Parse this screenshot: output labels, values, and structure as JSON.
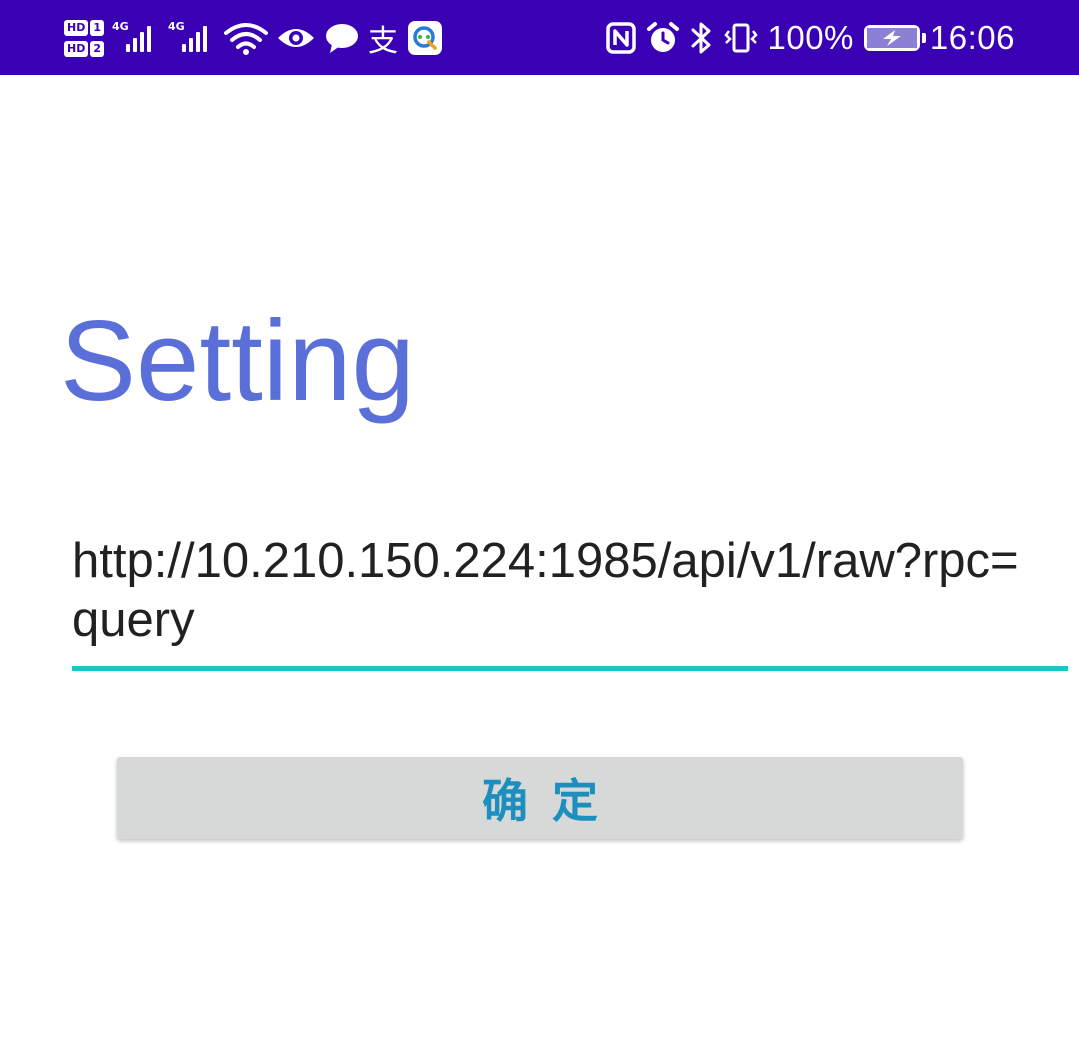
{
  "status_bar": {
    "sim1_label": "HD",
    "sim1_num": "1",
    "sim2_label": "HD",
    "sim2_num": "2",
    "sig1_gen": "4G",
    "sig2_gen": "4G",
    "pay_glyph": "支",
    "battery_percent": "100%",
    "time": "16:06",
    "bg_color": "#3a00b4",
    "icons": [
      "signal-icon",
      "signal-icon",
      "wifi-icon",
      "eye-icon",
      "chat-bubble-icon",
      "alipay-icon",
      "app-notification-icon",
      "nfc-icon",
      "alarm-icon",
      "bluetooth-icon",
      "vibrate-icon",
      "battery-charging-icon"
    ]
  },
  "page": {
    "title": "Setting",
    "title_color": "#5b6fd9"
  },
  "url_field": {
    "value": "http://10.210.150.224:1985/api/v1/raw?rpc=query",
    "underline_color": "#1bc7c4"
  },
  "confirm_button": {
    "label": "确定",
    "text_color": "#1c8fbf",
    "bg_color": "#d7d8d8"
  }
}
